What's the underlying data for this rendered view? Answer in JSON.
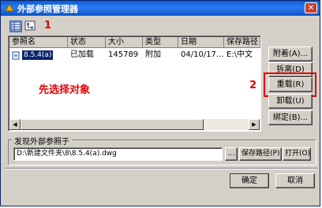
{
  "window": {
    "title": "外部参照管理器",
    "close_symbol": "✕"
  },
  "list": {
    "columns": [
      "参照名",
      "状态",
      "大小",
      "类型",
      "日期",
      "保存路径"
    ],
    "rows": [
      {
        "name": "8.5.4(a)",
        "status": "已加载",
        "size": "145789",
        "type": "附加",
        "date": "04/10/17...",
        "path": "E:\\中文"
      }
    ]
  },
  "buttons": {
    "attach": "附着(A)...",
    "detach": "拆离(D)",
    "reload": "重载(R)",
    "unload": "卸载(U)",
    "bind": "绑定(B)...",
    "browse": "...",
    "save_path": "保存路径(P)",
    "open": "打开(O)",
    "ok": "确定",
    "cancel": "取消"
  },
  "found_at": {
    "label": "发现外部参照于",
    "value": "D:\\新建文件夹\\8\\8.5.4(a).dwg"
  },
  "annotations": {
    "step1": "1",
    "step2": "2",
    "hint": "先选择对象"
  },
  "colors": {
    "titlebar": "#0a5cd6",
    "annotation": "#e60000",
    "selection": "#0a246a",
    "face": "#d4d0c8"
  }
}
